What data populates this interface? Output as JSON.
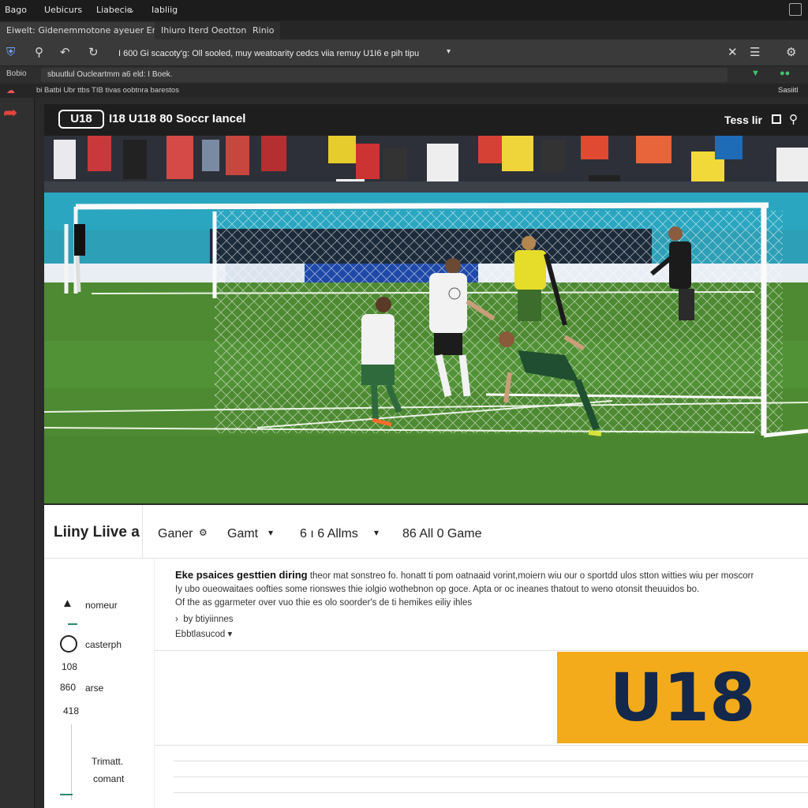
{
  "menubar": {
    "items": [
      "Bago",
      "Uebicurs",
      "Liabecie",
      "Iabliig"
    ]
  },
  "tabs": [
    "Eiwelt: Gidenemmotone ayeuer Enenfh",
    "Ihiuro Iterd Oeottonta",
    "Rinio"
  ],
  "toolbar": {
    "address": "I 600 Gi scacoty'g: Oll sooled, muy weatoarity cedcs viia remuy U1I6 e pih tipu"
  },
  "bookbar": {
    "left": "Bobio",
    "text": "sbuutlul Oucleartmm a6 eld: I Boek."
  },
  "status": {
    "text": "bi Batbi Ubr ttbs TIB tivas oobtnra barestos",
    "right": "Sasiitl"
  },
  "app": {
    "logo": "U18",
    "title": "I18 U118 80 Soccr Iancel",
    "right_link": "Tess lir"
  },
  "controls": {
    "live": "Liiny Liive a",
    "gamer": "Ganer",
    "gamt": "Gamt",
    "alims": "6 ı 6 Allms",
    "all_game": "86 All 0 Game"
  },
  "description": {
    "line1_bold": "Eke psaices gesttien diring",
    "line1": " theor mat sonstreo fo. honatt ti pom oatnaaid vorint,moiern wiu our o sportdd ulos stton witties wiu per moscorr",
    "line2": "Iy ubo oueowaitaes oofties some rionswes thie iolgio wothebnon op goce. Apta or oc ineanes thatout to weno otonsit theuuidos bo.",
    "line3": "Of the as ggarmeter over vuo thie es olo soorder's de ti hemikes eiliy ihles",
    "byline": "by btiyiinnes",
    "select": "Ebbtlasucod"
  },
  "sidebar": {
    "item1": "nomeur",
    "item2": "casterph",
    "n1": "108",
    "n2": "860",
    "n2_label": "arse",
    "n3": "418",
    "footer1": "Trimatt.",
    "footer2": "comant"
  },
  "badge": {
    "text": "U18",
    "bg": "#f3ab1b",
    "color": "#14284b"
  }
}
